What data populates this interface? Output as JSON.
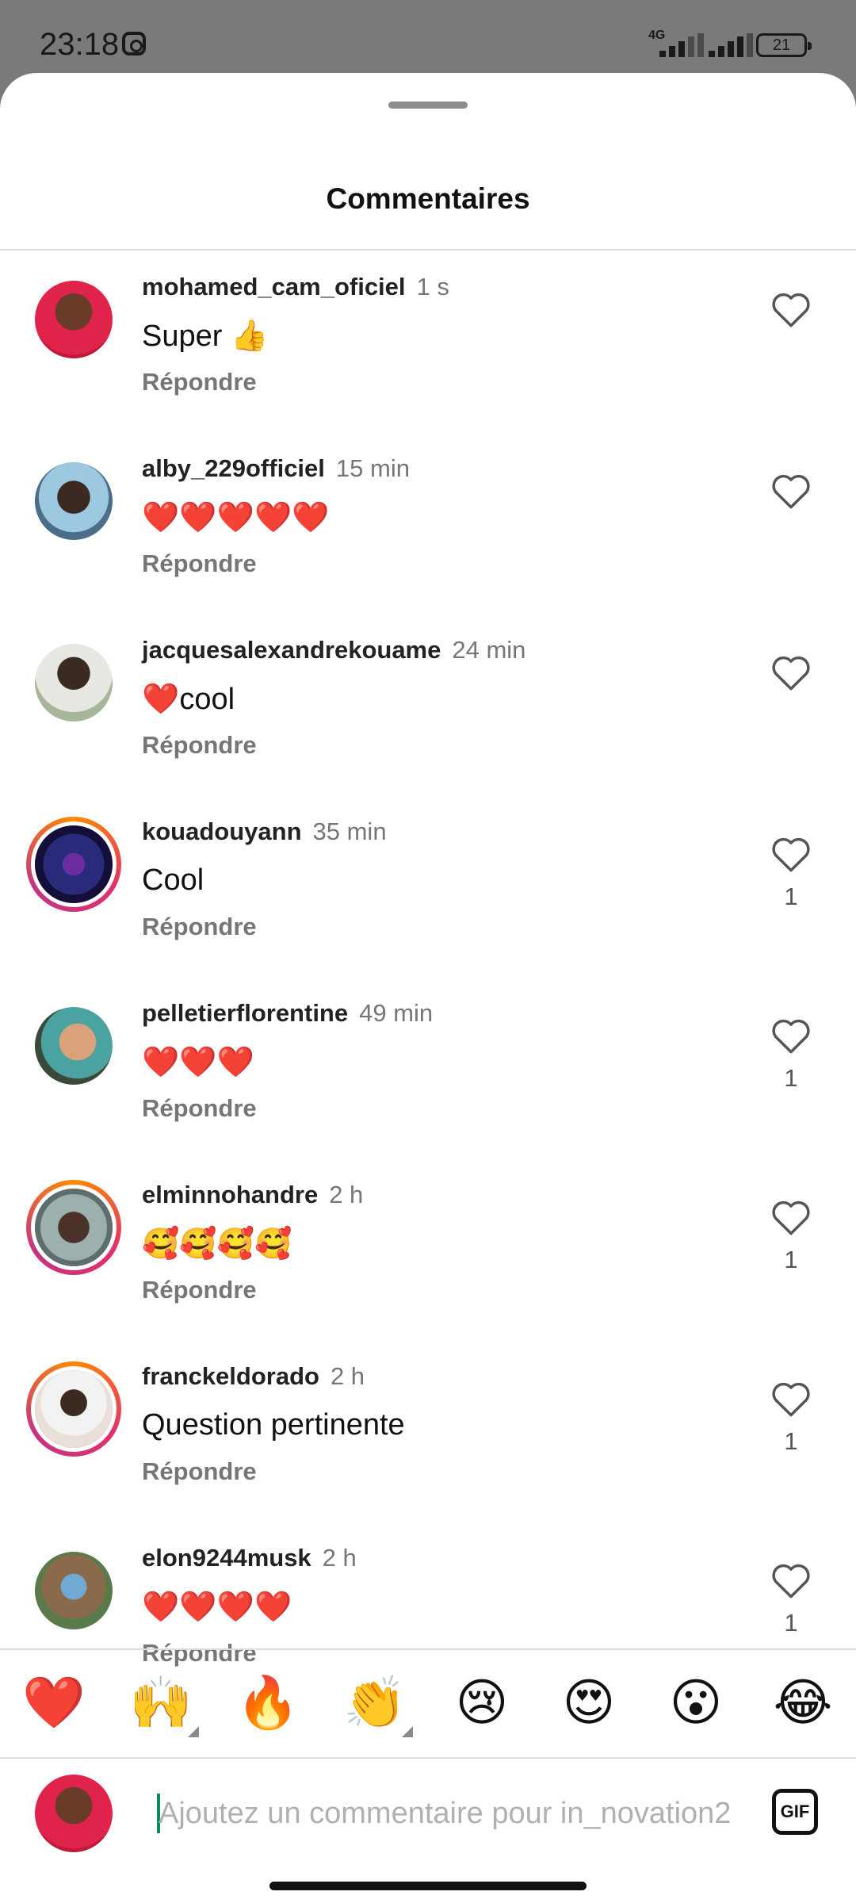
{
  "status_bar": {
    "time": "23:18",
    "network": "4G",
    "battery": "21"
  },
  "sheet": {
    "title": "Commentaires"
  },
  "comments": [
    {
      "username": "mohamed_cam_oficiel",
      "time": "1 s",
      "text": "Super 👍",
      "reply": "Répondre",
      "likes": ""
    },
    {
      "username": "alby_229officiel",
      "time": "15 min",
      "text": "❤️❤️❤️❤️❤️",
      "reply": "Répondre",
      "likes": ""
    },
    {
      "username": "jacquesalexandrekouame",
      "time": "24 min",
      "text": "❤️cool",
      "reply": "Répondre",
      "likes": ""
    },
    {
      "username": "kouadouyann",
      "time": "35 min",
      "text": "Cool",
      "reply": "Répondre",
      "likes": "1"
    },
    {
      "username": "pelletierflorentine",
      "time": "49 min",
      "text": "❤️❤️❤️",
      "reply": "Répondre",
      "likes": "1"
    },
    {
      "username": "elminnohandre",
      "time": "2 h",
      "text": "🥰🥰🥰🥰",
      "reply": "Répondre",
      "likes": "1"
    },
    {
      "username": "franckeldorado",
      "time": "2 h",
      "text": "Question pertinente",
      "reply": "Répondre",
      "likes": "1"
    },
    {
      "username": "elon9244musk",
      "time": "2 h",
      "text": "❤️❤️❤️❤️",
      "reply": "Répondre",
      "likes": "1"
    }
  ],
  "emoji_bar": [
    "❤️",
    "🙌",
    "🔥",
    "👏",
    "😢",
    "😍",
    "😮",
    "😂"
  ],
  "composer": {
    "placeholder": "Ajoutez un commentaire pour in_novation2",
    "gif_label": "GIF"
  },
  "colors": {
    "story_ring_start": "#ff8a00",
    "story_ring_end": "#c13584",
    "cursor": "#0b8a5c"
  }
}
